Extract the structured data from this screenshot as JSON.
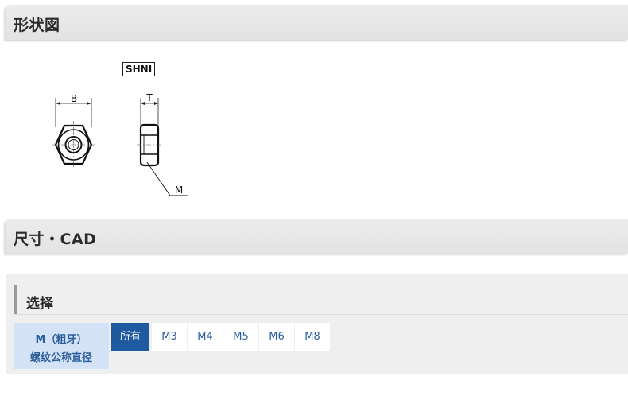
{
  "sections": {
    "shape_title": "形状図",
    "cad_title": "尺寸・CAD"
  },
  "drawing": {
    "model": "SHNI",
    "dim_width": "B",
    "dim_thickness": "T",
    "dim_thread": "M"
  },
  "selection": {
    "title": "选择",
    "filter_label_line1": "M（粗牙）",
    "filter_label_line2": "螺纹公称直径",
    "options": [
      "所有",
      "M3",
      "M4",
      "M5",
      "M6",
      "M8"
    ],
    "selected": "所有"
  },
  "colors": {
    "header_bg": "#e6e6e6",
    "label_bg": "#d3e2f4",
    "accent": "#1f5aa0",
    "link_text": "#2a5d9c"
  }
}
